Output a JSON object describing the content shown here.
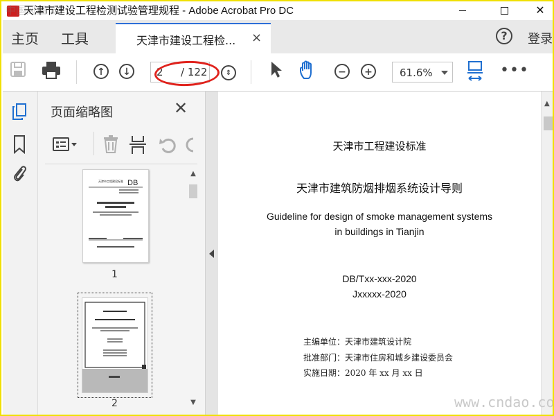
{
  "window": {
    "title": "天津市建设工程检测试验管理规程 - Adobe Acrobat Pro DC",
    "watermark_top_left": "中国风细节"
  },
  "menu": {
    "home": "主页",
    "tools": "工具",
    "login": "登录"
  },
  "tab": {
    "label": "天津市建设工程检...",
    "close": "×"
  },
  "toolbar": {
    "page_current": "2",
    "page_total": "/ 122",
    "zoom": "61.6%"
  },
  "thumbnail_panel": {
    "title": "页面缩略图",
    "pages": [
      {
        "number": "1"
      },
      {
        "number": "2"
      }
    ]
  },
  "document": {
    "standard": "天津市工程建设标准",
    "title_cn": "天津市建筑防烟排烟系统设计导则",
    "title_en_line1": "Guideline for design of smoke management systems",
    "title_en_line2": "in buildings in Tianjin",
    "code": "DB/Txx-xxx-2020",
    "record": "Jxxxxx-2020",
    "editor": "主编单位：天津市建筑设计院",
    "approver": "批准部门：天津市住房和城乡建设委员会",
    "effective_date": "实施日期：2020 年 xx 月 xx 日"
  },
  "watermark": "www.cndao.com",
  "colors": {
    "border": "#f0e000",
    "tab_accent": "#2d6fd8",
    "hand_tool": "#1f6fd0",
    "annotation": "#e0221c"
  }
}
